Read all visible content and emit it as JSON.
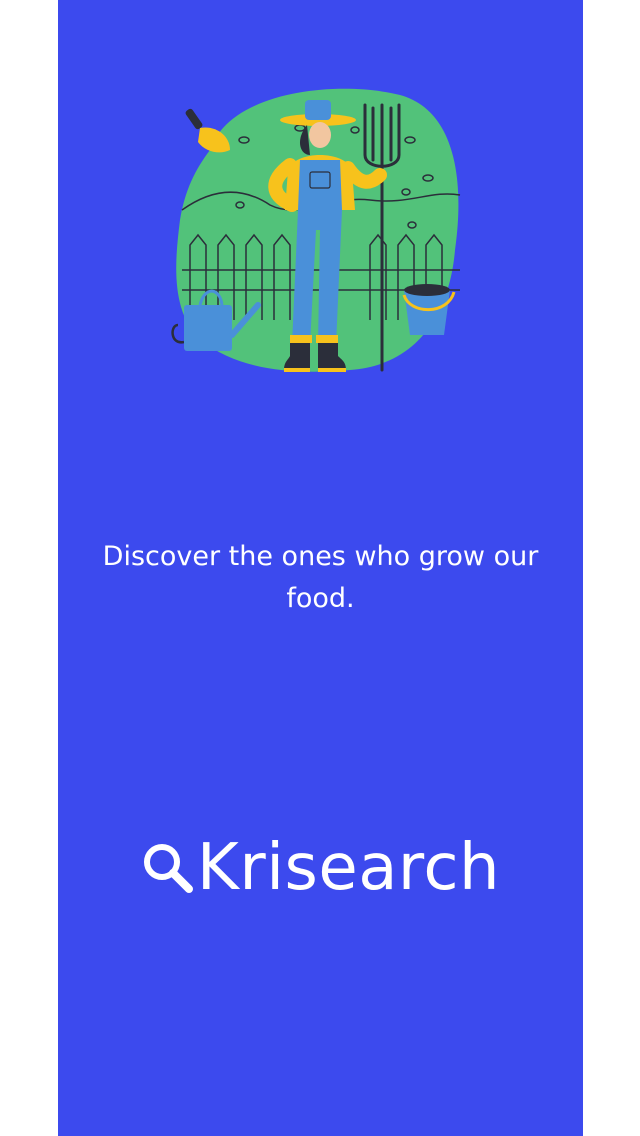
{
  "screen": {
    "background_color": "#3c4aee",
    "illustration_icon": "farmer-illustration"
  },
  "onboarding": {
    "tagline": "Discover the ones who grow our food."
  },
  "brand": {
    "logo_icon": "search-icon",
    "name": "Krisearch"
  },
  "colors": {
    "accent_green": "#52c27a",
    "accent_yellow": "#f7c21c",
    "accent_blue": "#4a90d9",
    "dark": "#2b2e3a"
  }
}
